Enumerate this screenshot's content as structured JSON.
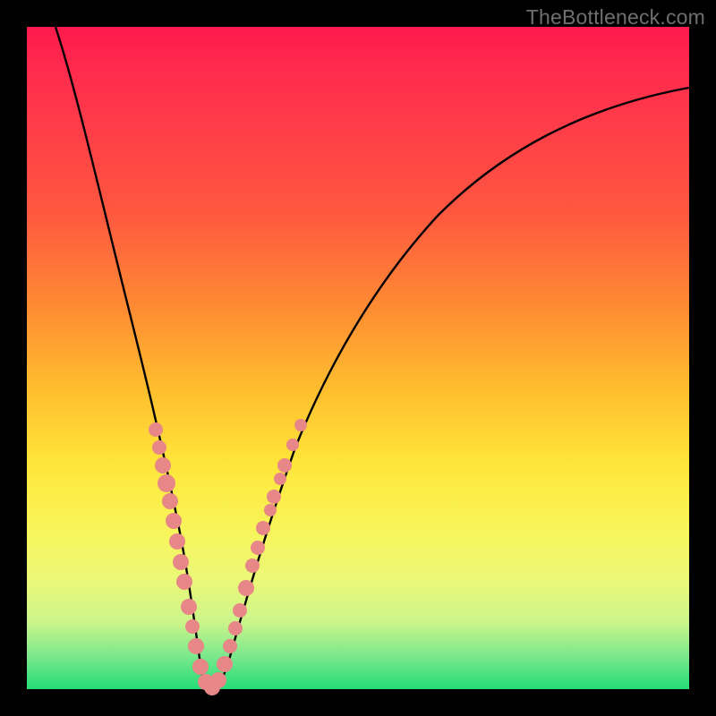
{
  "watermark": "TheBottleneck.com",
  "colors": {
    "background": "#000000",
    "gradient_top": "#ff1a4d",
    "gradient_bottom": "#22dd77",
    "curve": "#000000",
    "dots": "#e88787",
    "watermark_text": "#6f6f6f"
  },
  "chart_data": {
    "type": "line",
    "title": "",
    "xlabel": "",
    "ylabel": "",
    "xlim": [
      0,
      100
    ],
    "ylim": [
      0,
      100
    ],
    "grid": false,
    "legend": false,
    "annotations": [
      "TheBottleneck.com"
    ],
    "note": "V-shaped bottleneck curve; minimum near x≈25, y≈0. Axis values are estimated—chart has no tick labels.",
    "series": [
      {
        "name": "bottleneck-curve",
        "x": [
          0,
          5,
          10,
          14,
          17,
          20,
          22,
          24,
          25,
          26,
          28,
          30,
          33,
          37,
          42,
          50,
          60,
          72,
          85,
          100
        ],
        "y": [
          100,
          87,
          71,
          58,
          47,
          34,
          20,
          6,
          0,
          5,
          18,
          30,
          42,
          53,
          62,
          71,
          78,
          83,
          86,
          88
        ]
      }
    ],
    "cluster_points": {
      "name": "highlighted-samples",
      "x": [
        17.0,
        17.5,
        18.3,
        19.2,
        19.8,
        20.3,
        20.9,
        21.5,
        22.0,
        22.8,
        23.2,
        23.8,
        24.5,
        25.0,
        25.6,
        26.4,
        27.2,
        27.7,
        28.6,
        29.2,
        30.0,
        30.8,
        31.5,
        32.5
      ],
      "y": [
        46,
        43,
        39,
        35,
        31,
        28,
        24,
        20,
        16,
        10,
        7,
        4,
        1,
        0,
        2,
        6,
        11,
        15,
        21,
        25,
        30,
        35,
        39,
        44
      ]
    }
  }
}
